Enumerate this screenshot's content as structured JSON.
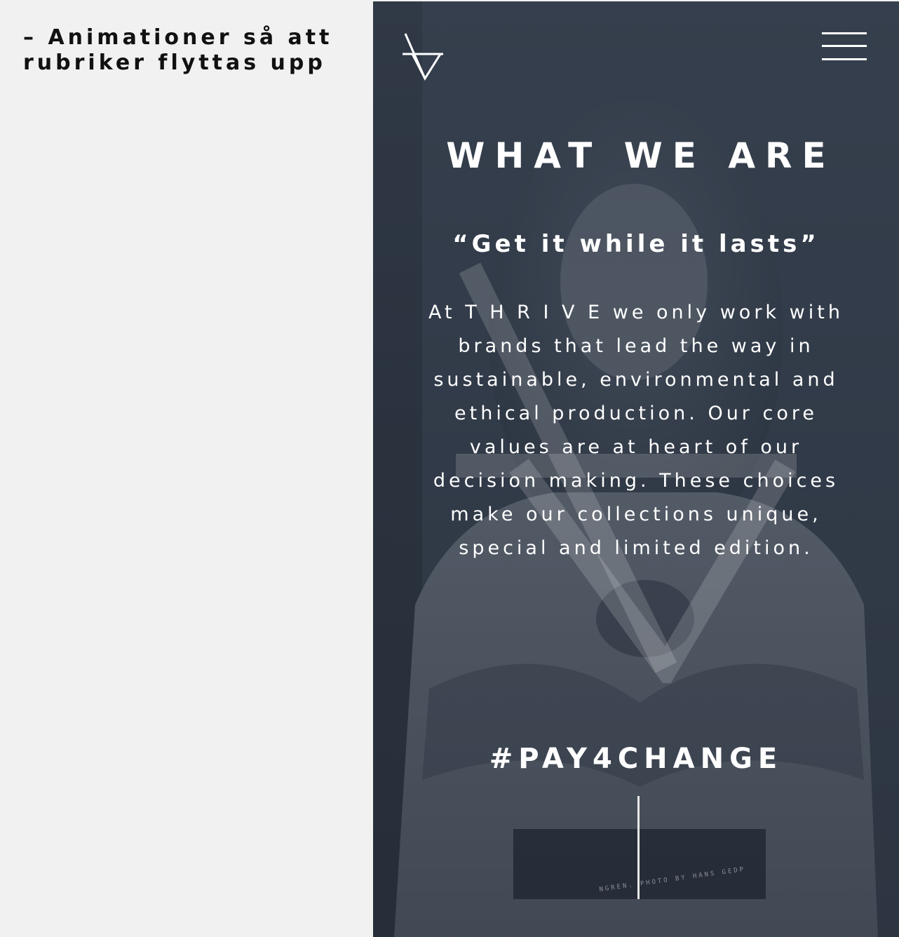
{
  "note": {
    "text": "– Animationer så att rubriker flyttas upp"
  },
  "header": {
    "logo_icon": "thrive-logo-icon",
    "menu_icon": "hamburger-menu-icon"
  },
  "section": {
    "heading": "WHAT WE ARE",
    "quote": "“Get it while it lasts”",
    "body": "At T H R I V E we only work with brands that lead the way in sustainable, environmental and ethical production. Our core values are at heart of our decision making. These choices make our collections unique, special and limited edition."
  },
  "cta": {
    "hashtag": "#PAY4CHANGE"
  },
  "photo": {
    "credit": "NGREN. PHOTO BY HANS GEDP"
  },
  "colors": {
    "page_bg": "#f1f1f1",
    "overlay": "#343e4c",
    "text_light": "#ffffff",
    "text_dark": "#111111"
  }
}
